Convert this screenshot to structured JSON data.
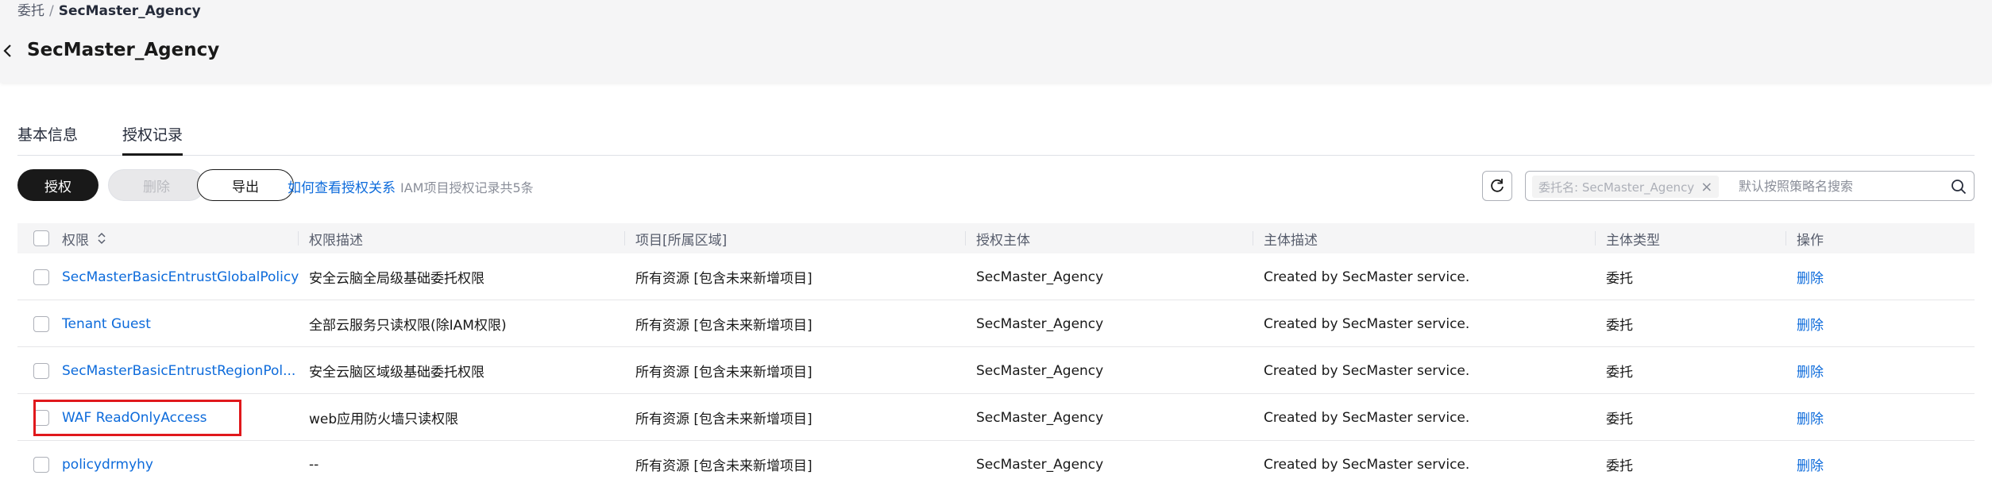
{
  "breadcrumb": {
    "parent": "委托",
    "separator": "/",
    "current": "SecMaster_Agency"
  },
  "page": {
    "title": "SecMaster_Agency"
  },
  "tabs": [
    {
      "label": "基本信息",
      "active": false
    },
    {
      "label": "授权记录",
      "active": true
    }
  ],
  "toolbar": {
    "authorize_label": "授权",
    "delete_label": "删除",
    "export_label": "导出",
    "help_link": "如何查看授权关系",
    "record_count_text": "IAM项目授权记录共5条"
  },
  "search": {
    "filter_tag": "委托名: SecMaster_Agency",
    "placeholder": "默认按照策略名搜索"
  },
  "table": {
    "columns": [
      "权限",
      "权限描述",
      "项目[所属区域]",
      "授权主体",
      "主体描述",
      "主体类型",
      "操作"
    ],
    "rows": [
      {
        "policy": "SecMasterBasicEntrustGlobalPolicy",
        "description": "安全云脑全局级基础委托权限",
        "project": "所有资源 [包含未来新增项目]",
        "principal": "SecMaster_Agency",
        "principal_desc": "Created by SecMaster service.",
        "principal_type": "委托",
        "action": "删除"
      },
      {
        "policy": "Tenant Guest",
        "description": "全部云服务只读权限(除IAM权限)",
        "project": "所有资源 [包含未来新增项目]",
        "principal": "SecMaster_Agency",
        "principal_desc": "Created by SecMaster service.",
        "principal_type": "委托",
        "action": "删除"
      },
      {
        "policy": "SecMasterBasicEntrustRegionPol...",
        "description": "安全云脑区域级基础委托权限",
        "project": "所有资源 [包含未来新增项目]",
        "principal": "SecMaster_Agency",
        "principal_desc": "Created by SecMaster service.",
        "principal_type": "委托",
        "action": "删除"
      },
      {
        "policy": "WAF ReadOnlyAccess",
        "description": "web应用防火墙只读权限",
        "project": "所有资源 [包含未来新增项目]",
        "principal": "SecMaster_Agency",
        "principal_desc": "Created by SecMaster service.",
        "principal_type": "委托",
        "action": "删除"
      },
      {
        "policy": "policydrmyhy",
        "description": "--",
        "project": "所有资源 [包含未来新增项目]",
        "principal": "SecMaster_Agency",
        "principal_desc": "Created by SecMaster service.",
        "principal_type": "委托",
        "action": "删除"
      }
    ]
  },
  "colors": {
    "link": "#0d6bdb",
    "primary": "#191919",
    "highlight": "#e0181c",
    "header_bg": "#f5f5f6"
  }
}
